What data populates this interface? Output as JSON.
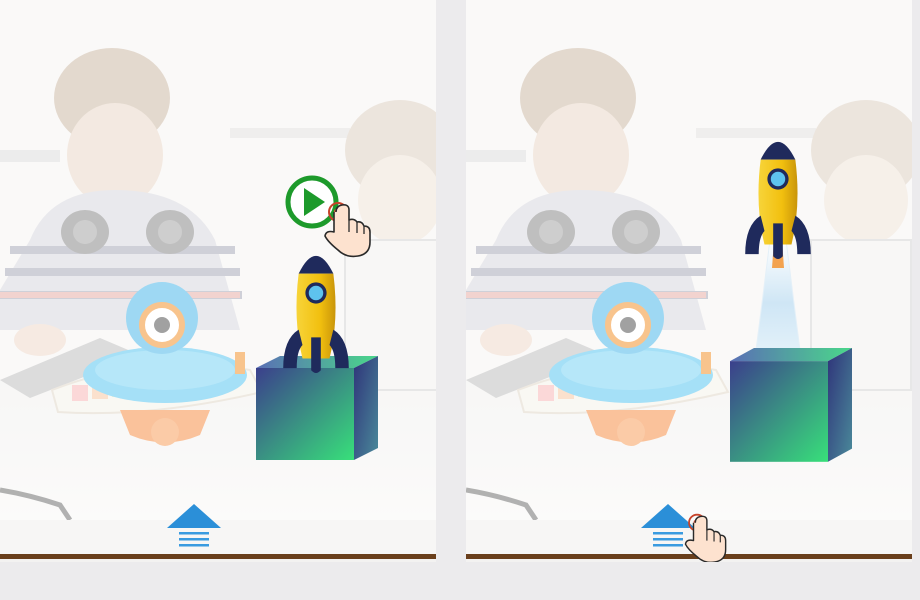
{
  "screen": {
    "background_color": "#ecebed",
    "baseline_color": "#6a3f1c",
    "overlay_color": "#ffffff"
  },
  "panels": [
    {
      "id": "left",
      "step": "before-launch",
      "icons": [
        "photo-background",
        "robot-toy",
        "xylophone",
        "rocket-icon",
        "cube-platform",
        "play-button-icon",
        "hand-pointer-icon",
        "up-arrow-icon"
      ]
    },
    {
      "id": "right",
      "step": "after-launch",
      "icons": [
        "photo-background",
        "robot-toy",
        "xylophone",
        "rocket-icon",
        "rocket-exhaust",
        "cube-platform",
        "up-arrow-icon",
        "hand-pointer-icon"
      ]
    }
  ],
  "colors": {
    "play_button": "#1d9a2b",
    "up_arrow": "#2b8fd8",
    "rocket_body": "#f4c20d",
    "rocket_fins": "#1f2a5c",
    "cube_top": "#5ad07a",
    "cube_side": "#3b3f8c",
    "hand_outline": "#c7432a"
  }
}
